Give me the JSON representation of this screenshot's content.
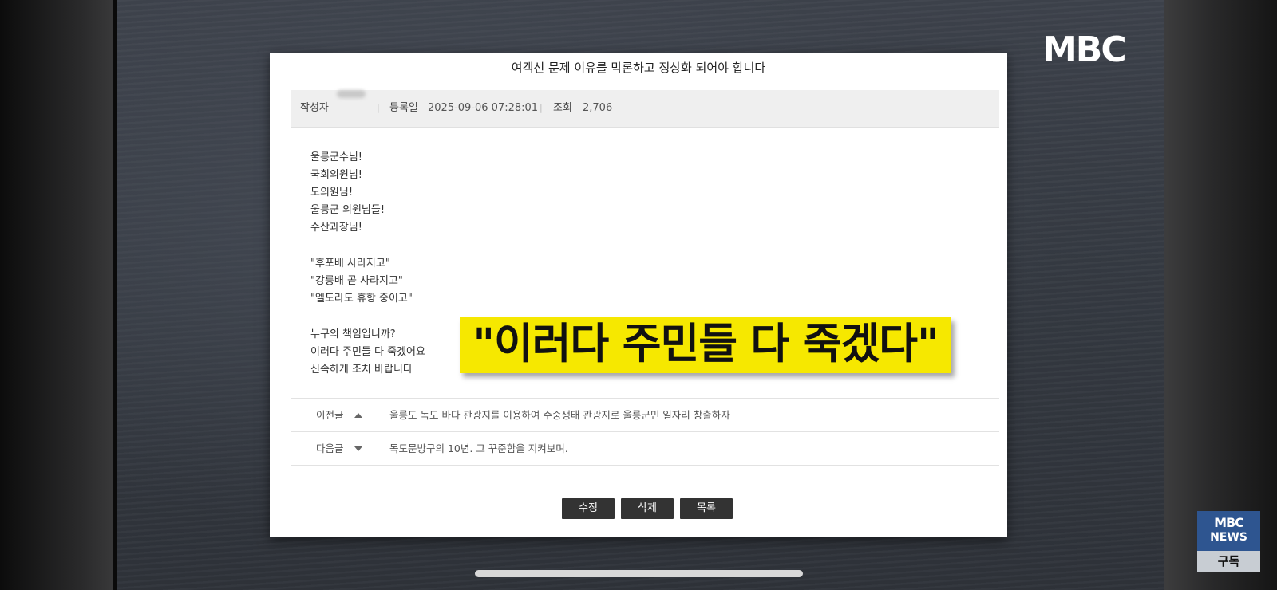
{
  "channel_logo": "MBC",
  "post": {
    "title": "여객선 문제 이유를 막론하고 정상화 되어야 합니다",
    "meta": {
      "author_label": "작성자",
      "date_label": "등록일",
      "date_value": "2025-09-06 07:28:01",
      "views_label": "조회",
      "views_value": "2,706",
      "separator": "|"
    },
    "body_lines": [
      "울릉군수님!",
      "국회의원님!",
      "도의원님!",
      "울릉군 의원님들!",
      "수산과장님!",
      "",
      "\"후포배 사라지고\"",
      "\"강릉배 곧 사라지고\"",
      "\"엘도라도 휴항 중이고\"",
      "",
      "누구의 책임입니까?",
      "이러다 주민들 다 죽겠어요",
      "신속하게 조치 바랍니다"
    ]
  },
  "caption": "\"이러다 주민들 다 죽겠다\"",
  "navigation": {
    "prev": {
      "label": "이전글",
      "title": "울릉도 독도 바다 관광지를 이용하여 수중생태 관광지로 울릉군민 일자리 창출하자"
    },
    "next": {
      "label": "다음글",
      "title": "독도문방구의 10년. 그 꾸준함을 지켜보며."
    }
  },
  "buttons": {
    "edit": "수정",
    "delete": "삭제",
    "list": "목록"
  },
  "badge": {
    "top_line": "MBC",
    "second_line": "NEWS",
    "subscribe": "구독"
  }
}
